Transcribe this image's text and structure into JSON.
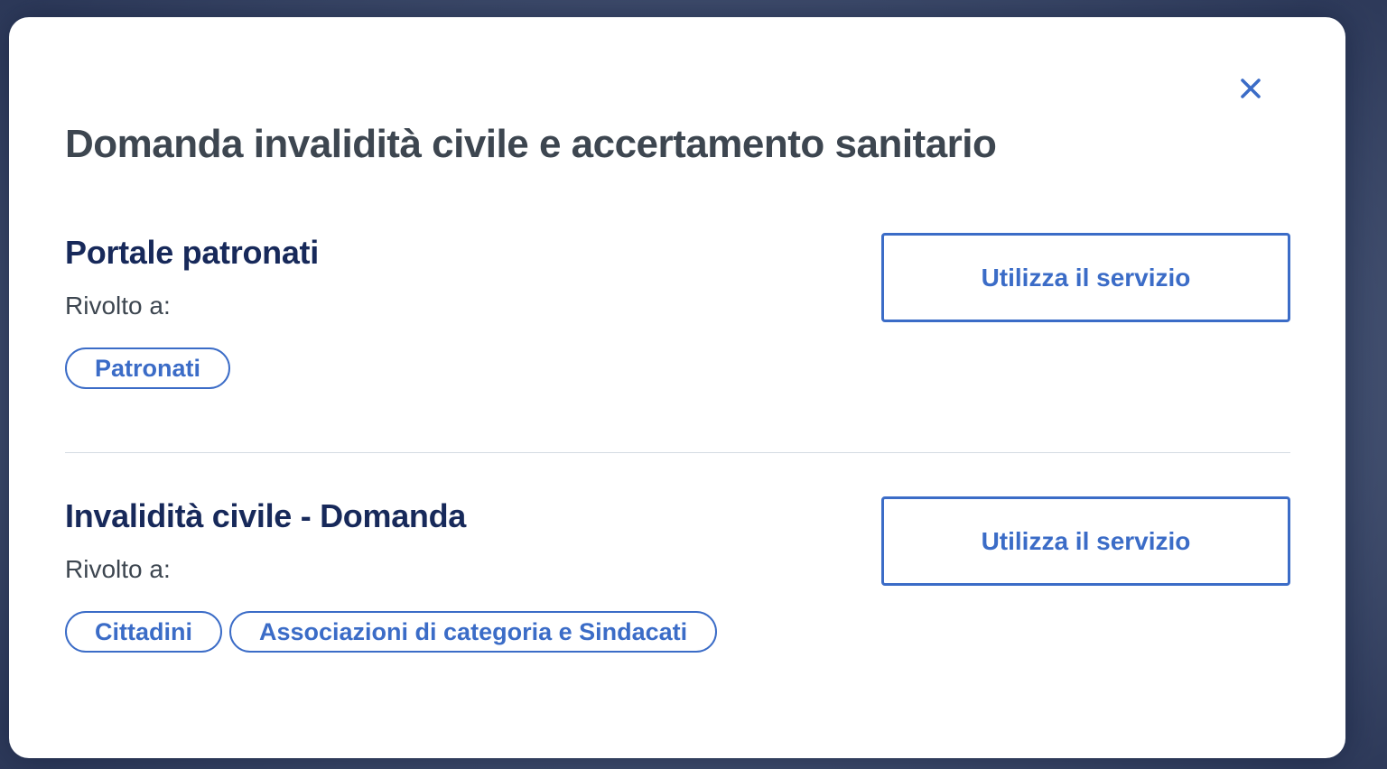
{
  "modal": {
    "title": "Domanda invalidità civile e accertamento sanitario",
    "close_icon": "close-icon",
    "services": [
      {
        "title": "Portale patronati",
        "target_label": "Rivolto a:",
        "tags": [
          "Patronati"
        ],
        "button_label": "Utilizza il servizio"
      },
      {
        "title": "Invalidità civile - Domanda",
        "target_label": "Rivolto a:",
        "tags": [
          "Cittadini",
          "Associazioni di categoria e Sindacati"
        ],
        "button_label": "Utilizza il servizio"
      }
    ]
  },
  "colors": {
    "accent": "#3b6cc7",
    "title": "#3d4650",
    "service_title": "#17295a",
    "divider": "#d4dbe3",
    "backdrop": "#4a5878"
  }
}
